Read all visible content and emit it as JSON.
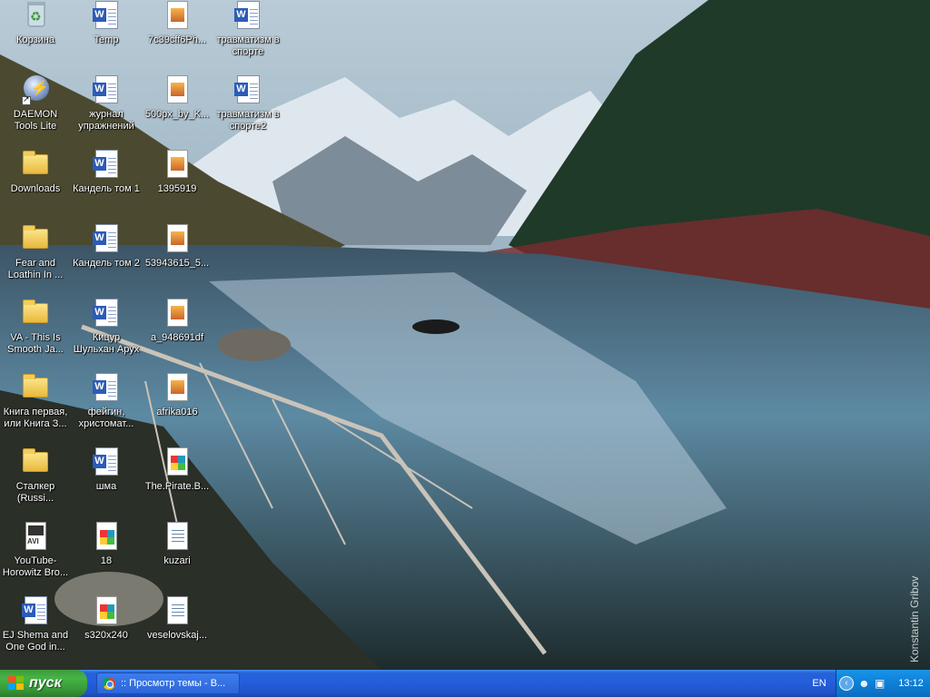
{
  "desktop": {
    "watermark": "Konstantin Gribov",
    "icons": [
      {
        "label": "Корзина",
        "type": "recycle-bin"
      },
      {
        "label": "Temp",
        "type": "word-doc"
      },
      {
        "label": "7c39cff6Ph...",
        "type": "image"
      },
      {
        "label": "травматизм в спорте",
        "type": "word-doc"
      },
      {
        "label": "DAEMON Tools Lite",
        "type": "shortcut"
      },
      {
        "label": "журнал упражнений",
        "type": "word-doc"
      },
      {
        "label": "500px_by_K...",
        "type": "image"
      },
      {
        "label": "травматизм в спорте2",
        "type": "word-doc"
      },
      {
        "label": "Downloads",
        "type": "folder"
      },
      {
        "label": "Кандель том 1",
        "type": "word-doc"
      },
      {
        "label": "1395919",
        "type": "image"
      },
      {
        "label": "Fear and Loathin In ...",
        "type": "folder"
      },
      {
        "label": "Кандель том 2",
        "type": "word-doc"
      },
      {
        "label": "53943615_5...",
        "type": "image"
      },
      {
        "label": "VA - This Is Smooth Ja...",
        "type": "folder"
      },
      {
        "label": "Кицур Шульхан Арух",
        "type": "word-doc"
      },
      {
        "label": "a_948691df",
        "type": "image"
      },
      {
        "label": "Книга первая, или Книга З...",
        "type": "folder"
      },
      {
        "label": "фейгин, христомат...",
        "type": "word-doc"
      },
      {
        "label": "afrika016",
        "type": "image"
      },
      {
        "label": "Сталкер (Russi...",
        "type": "folder"
      },
      {
        "label": "шма",
        "type": "word-doc"
      },
      {
        "label": "The.Pirate.B...",
        "type": "picture"
      },
      {
        "label": "YouTube-Horowitz Bro...",
        "type": "video-avi"
      },
      {
        "label": "18",
        "type": "picture"
      },
      {
        "label": "kuzari",
        "type": "text-doc"
      },
      {
        "label": "EJ Shema and One God in...",
        "type": "word-doc"
      },
      {
        "label": "s320x240",
        "type": "picture"
      },
      {
        "label": "veselovskaj...",
        "type": "text-doc"
      }
    ]
  },
  "taskbar": {
    "start_label": "пуск",
    "task_label": ":: Просмотр темы - В...",
    "language": "EN",
    "clock": "13:12"
  },
  "colors": {
    "taskbar_blue": "#245edb",
    "start_green": "#46b446",
    "tray_blue": "#0f7fd6"
  }
}
